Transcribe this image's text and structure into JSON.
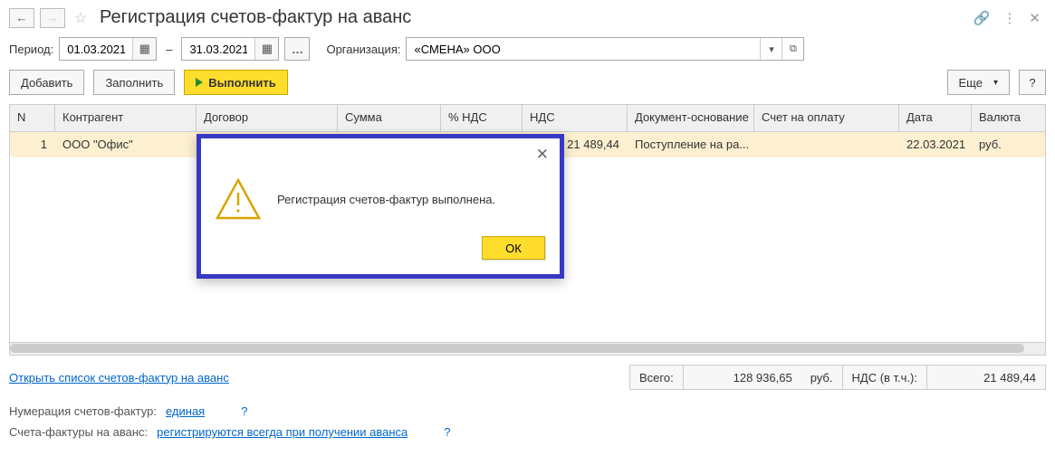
{
  "header": {
    "title": "Регистрация счетов-фактур на аванс"
  },
  "filters": {
    "period_label": "Период:",
    "date_from": "01.03.2021",
    "date_to": "31.03.2021",
    "org_label": "Организация:",
    "org_value": "«СМЕНА» ООО"
  },
  "toolbar": {
    "add": "Добавить",
    "fill": "Заполнить",
    "run": "Выполнить",
    "more": "Еще",
    "help": "?"
  },
  "table": {
    "headers": {
      "n": "N",
      "kontragent": "Контрагент",
      "dogovor": "Договор",
      "summa": "Сумма",
      "pnds": "% НДС",
      "nds": "НДС",
      "doc": "Документ-основание",
      "schet": "Счет на оплату",
      "date": "Дата",
      "valuta": "Валюта"
    },
    "rows": [
      {
        "n": "1",
        "kontragent": "ООО \"Офис\"",
        "dogovor": "",
        "summa": "",
        "pnds": "",
        "nds": "21 489,44",
        "doc": "Поступление на ра...",
        "schet": "",
        "date": "22.03.2021",
        "valuta": "руб."
      }
    ]
  },
  "footer": {
    "open_list": "Открыть список счетов-фактур на аванс",
    "total_label": "Всего:",
    "total_value": "128 936,65",
    "total_cur": "руб.",
    "nds_label": "НДС (в т.ч.):",
    "nds_value": "21 489,44",
    "num_label": "Нумерация счетов-фактур:",
    "num_link": "единая",
    "sf_label": "Счета-фактуры на аванс:",
    "sf_link": "регистрируются всегда при получении аванса",
    "q": "?"
  },
  "modal": {
    "message": "Регистрация счетов-фактур выполнена.",
    "ok": "ОК"
  }
}
